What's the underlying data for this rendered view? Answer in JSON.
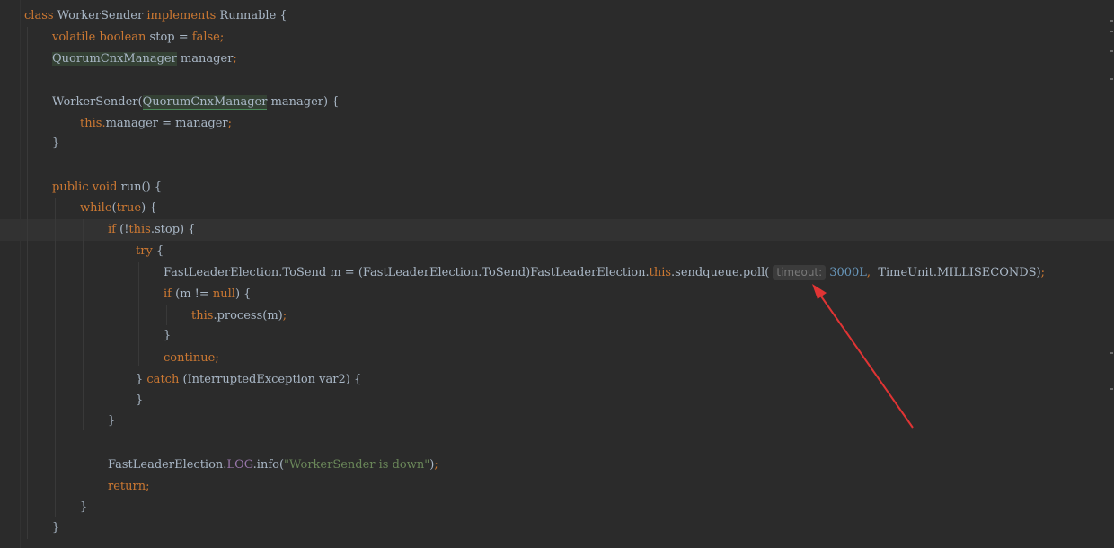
{
  "code": {
    "l1": {
      "kw_class": "class",
      "name": "WorkerSender",
      "kw_impl": "implements",
      "iface": "Runnable",
      "brace": "{"
    },
    "l2": {
      "kw1": "volatile",
      "kw2": "boolean",
      "ident": "stop",
      "op": "=",
      "kw3": "false",
      "semi": ";"
    },
    "l3": {
      "type": "QuorumCnxManager",
      "ident": "manager",
      "semi": ";"
    },
    "l4": {
      "name": "WorkerSender",
      "paren_open": "(",
      "type": "QuorumCnxManager",
      "rest": "manager) {"
    },
    "l5": {
      "kw_this": "this",
      "dot": ".",
      "rest": "manager = manager",
      "semi": ";"
    },
    "l6": {
      "text": "}"
    },
    "l7": {
      "kw1": "public",
      "kw2": "void",
      "rest": "run() {"
    },
    "l8": {
      "kw": "while",
      "p1": "(",
      "kw_true": "true",
      "rest": ") {"
    },
    "l9": {
      "kw_if": "if",
      "p1": "(!",
      "kw_this": "this",
      "rest": ".stop) {"
    },
    "l10": {
      "kw_try": "try",
      "rest": "{"
    },
    "l11": {
      "part1": "FastLeaderElection.ToSend m = (FastLeaderElection.ToSend)FastLeaderElection.",
      "kw_this": "this",
      "part2": ".sendqueue.poll(",
      "hint": "timeout:",
      "num": "3000L",
      "comma": ",",
      "part3": "TimeUnit.MILLISECONDS)",
      "semi": ";"
    },
    "l12": {
      "kw_if": "if",
      "p1": "(m != ",
      "kw_null": "null",
      "rest": ") {"
    },
    "l13": {
      "kw_this": "this",
      "rest": ".process(m)",
      "semi": ";"
    },
    "l14": {
      "text": "}"
    },
    "l15": {
      "kw": "continue",
      "semi": ";"
    },
    "l16": {
      "pre": "} ",
      "kw_catch": "catch",
      "rest": "(InterruptedException var2) {"
    },
    "l17": {
      "text": "}"
    },
    "l18": {
      "text": "}"
    },
    "l19": {
      "pre": "FastLeaderElection.",
      "field": "LOG",
      "mid": ".info(",
      "str": "\"WorkerSender is down\"",
      "end": ")",
      "semi": ";"
    },
    "l20": {
      "kw": "return",
      "semi": ";"
    },
    "l21": {
      "text": "}"
    },
    "l22": {
      "text": "}"
    }
  },
  "annotation": {
    "arrow_color": "#e03434"
  },
  "colors": {
    "background": "#2b2b2b",
    "keyword": "#cc7832",
    "string": "#6a8759",
    "number": "#6897bb",
    "text": "#a9b7c6"
  }
}
